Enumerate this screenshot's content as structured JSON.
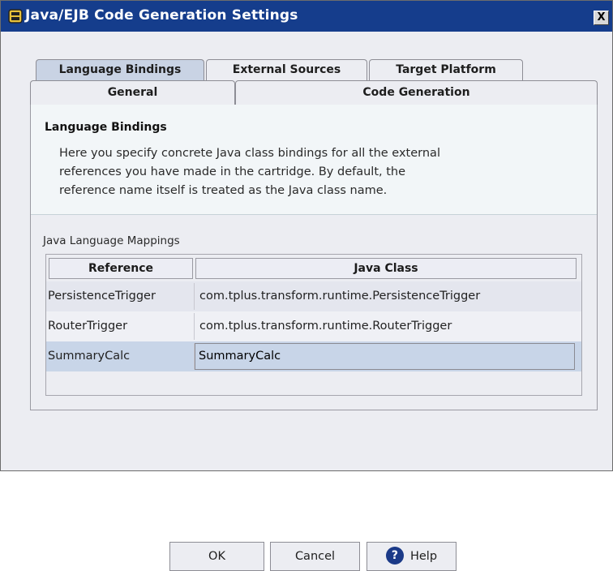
{
  "window": {
    "title": "Java/EJB Code Generation Settings",
    "close_label": "X"
  },
  "tabs": {
    "row1": [
      {
        "label": "Language Bindings",
        "active": true
      },
      {
        "label": "External Sources",
        "active": false
      },
      {
        "label": "Target Platform",
        "active": false
      }
    ],
    "row2": [
      {
        "label": "General"
      },
      {
        "label": "Code Generation"
      }
    ]
  },
  "panel": {
    "section_title": "Language Bindings",
    "description_lines": [
      "Here you specify concrete Java class bindings for all the external",
      "references you have made in the cartridge. By default, the",
      "reference name itself is treated as the Java class name."
    ]
  },
  "mappings": {
    "label": "Java Language Mappings",
    "columns": [
      "Reference",
      "Java Class"
    ],
    "rows": [
      {
        "reference": "PersistenceTrigger",
        "java_class": "com.tplus.transform.runtime.PersistenceTrigger",
        "selected": false
      },
      {
        "reference": "RouterTrigger",
        "java_class": "com.tplus.transform.runtime.RouterTrigger",
        "selected": false
      },
      {
        "reference": "SummaryCalc",
        "java_class": "SummaryCalc",
        "selected": true
      }
    ]
  },
  "buttons": {
    "ok": "OK",
    "cancel": "Cancel",
    "help": "Help",
    "help_icon_glyph": "?"
  },
  "colors": {
    "titlebar": "#153d8c",
    "active_tab": "#c9d3e4",
    "selected_row": "#c8d5e8",
    "row_alt": "#e6e8f0"
  }
}
